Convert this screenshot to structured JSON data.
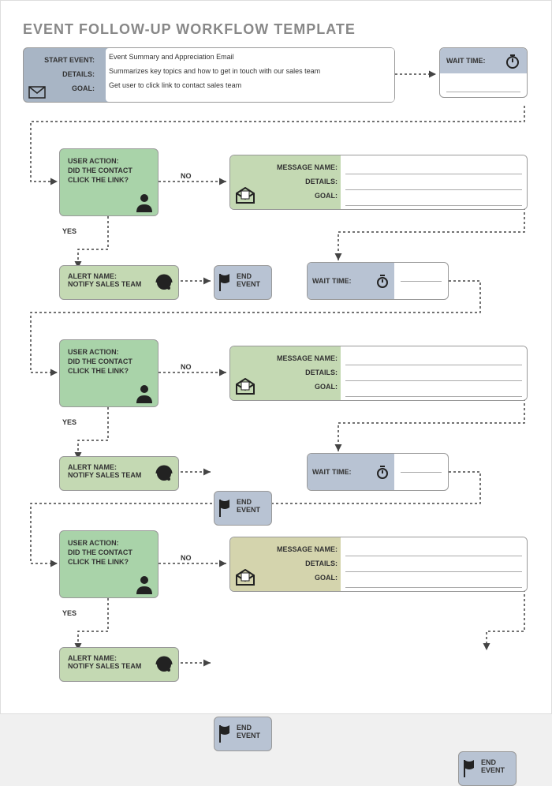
{
  "title": "EVENT FOLLOW-UP WORKFLOW TEMPLATE",
  "start": {
    "r1": "START EVENT:",
    "v1": "Event Summary and Appreciation Email",
    "r2": "DETAILS:",
    "v2": "Summarizes key topics and how to get in touch with our sales team",
    "r3": "GOAL:",
    "v3": "Get user to click link to contact sales team"
  },
  "wait": {
    "label": "WAIT TIME:"
  },
  "decision": {
    "label": "USER ACTION:",
    "text": "DID THE CONTACT CLICK THE LINK?"
  },
  "msg": {
    "r1": "MESSAGE NAME:",
    "r2": "DETAILS:",
    "r3": "GOAL:"
  },
  "alert": {
    "label": "ALERT NAME:",
    "text": "NOTIFY SALES TEAM"
  },
  "end": {
    "label": "END EVENT"
  },
  "flow": {
    "yes": "YES",
    "no": "NO"
  }
}
